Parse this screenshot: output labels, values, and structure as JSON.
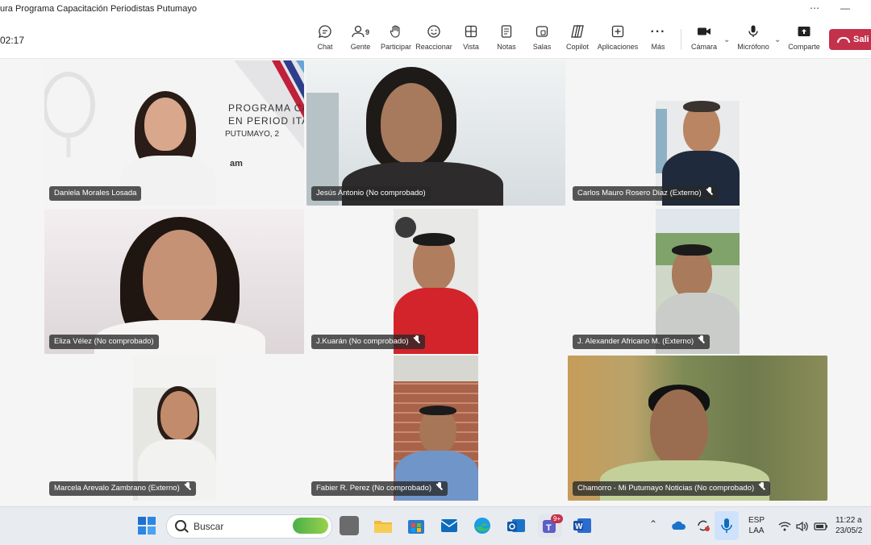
{
  "window": {
    "title": "ura Programa Capacitación Periodistas Putumayo",
    "controls": [
      "⋯",
      "—"
    ]
  },
  "meeting": {
    "timer": "02:17",
    "toolbar": [
      {
        "id": "chat",
        "label": "Chat",
        "icon": "chat-icon"
      },
      {
        "id": "people",
        "label": "Gente",
        "icon": "people-icon",
        "count": "9"
      },
      {
        "id": "raise",
        "label": "Participar",
        "icon": "raise-hand-icon"
      },
      {
        "id": "react",
        "label": "Reaccionar",
        "icon": "smiley-icon"
      },
      {
        "id": "view",
        "label": "Vista",
        "icon": "grid-icon"
      },
      {
        "id": "notes",
        "label": "Notas",
        "icon": "notes-icon"
      },
      {
        "id": "rooms",
        "label": "Salas",
        "icon": "rooms-icon"
      },
      {
        "id": "copilot",
        "label": "Copilot",
        "icon": "copilot-icon"
      },
      {
        "id": "apps",
        "label": "Aplicaciones",
        "icon": "plus-icon"
      },
      {
        "id": "more",
        "label": "Más",
        "icon": "more-icon"
      },
      {
        "id": "camera",
        "label": "Cámara",
        "icon": "camera-icon"
      },
      {
        "id": "mic",
        "label": "Micrófono",
        "icon": "microphone-icon"
      },
      {
        "id": "share",
        "label": "Comparte",
        "icon": "share-icon"
      }
    ],
    "leave_label": "Sali"
  },
  "participants": [
    {
      "name": "Daniela Morales Losada",
      "muted": false
    },
    {
      "name": "Jesús Antonio (No comprobado)",
      "muted": false
    },
    {
      "name": "Carlos Mauro Rosero Diaz (Externo)",
      "muted": true
    },
    {
      "name": "Eliza Vélez (No comprobado)",
      "muted": false
    },
    {
      "name": "J.Kuarán (No comprobado)",
      "muted": true
    },
    {
      "name": "J. Alexander Africano M. (Externo)",
      "muted": true
    },
    {
      "name": "Marcela Arevalo Zambrano (Externo)",
      "muted": true
    },
    {
      "name": "Fabier R. Perez (No comprobado)",
      "muted": true
    },
    {
      "name": "Chamorro - Mi Putumayo Noticias (No comprobado)",
      "muted": true
    }
  ],
  "banner": {
    "line1": "PROGRAMA",
    "line1b": "CACITACIÒN",
    "line2": "EN PERIOD",
    "line2b": "ITAL",
    "line3": "PUTUMAYO, 2",
    "logo": "am"
  },
  "taskbar": {
    "search_placeholder": "Buscar",
    "teams_badge": "9+",
    "language": "ESP",
    "layout": "LAA",
    "time": "11:22 a",
    "date": "23/05/2"
  }
}
